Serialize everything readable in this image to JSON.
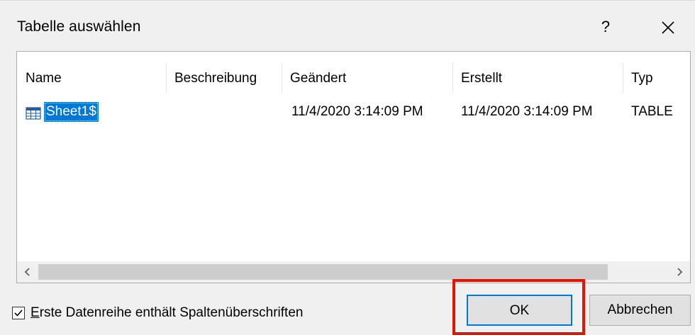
{
  "dialog": {
    "title": "Tabelle auswählen",
    "help_label": "?"
  },
  "list": {
    "columns": [
      "Name",
      "Beschreibung",
      "Geändert",
      "Erstellt",
      "Typ"
    ],
    "rows": [
      {
        "name": "Sheet1$",
        "description": "",
        "modified": "11/4/2020 3:14:09 PM",
        "created": "11/4/2020 3:14:09 PM",
        "type": "TABLE",
        "icon": "table-icon",
        "selected": true
      }
    ]
  },
  "checkbox": {
    "checked": true,
    "label_underlined": "E",
    "label_rest": "rste Datenreihe enthält Spaltenüberschriften"
  },
  "buttons": {
    "ok_label": "OK",
    "cancel_label": "Abbrechen"
  },
  "colors": {
    "accent": "#0078d7",
    "highlight_box": "#e51400"
  }
}
